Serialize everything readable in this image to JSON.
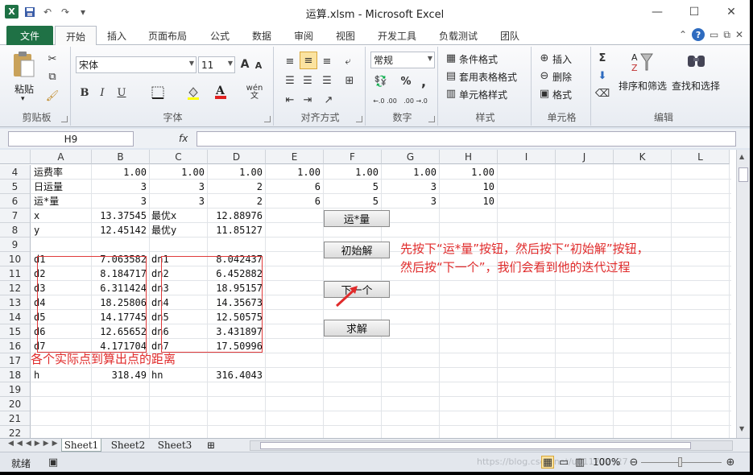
{
  "window": {
    "title": "运算.xlsm - Microsoft Excel",
    "controls": [
      "—",
      "☐",
      "✕"
    ]
  },
  "qat": {
    "logo": "X"
  },
  "tabs": {
    "file": "文件",
    "items": [
      "开始",
      "插入",
      "页面布局",
      "公式",
      "数据",
      "审阅",
      "视图",
      "开发工具",
      "负载测试",
      "团队"
    ],
    "active_index": 0
  },
  "ribbon": {
    "clipboard": {
      "paste": "粘贴",
      "label": "剪贴板"
    },
    "font": {
      "name": "宋体",
      "size": "11",
      "label": "字体",
      "bold": "B",
      "italic": "I",
      "underline": "U",
      "grow": "A",
      "shrink": "A",
      "wen": "wén"
    },
    "alignment": {
      "label": "对齐方式"
    },
    "number": {
      "format": "常规",
      "label": "数字",
      "percent": "%",
      "comma": ",",
      "inc": "←.0 .00",
      "dec": ".00 →.0"
    },
    "styles": {
      "cond": "条件格式",
      "table": "套用表格格式",
      "cell": "单元格样式",
      "label": "样式"
    },
    "cells": {
      "insert": "插入",
      "delete": "删除",
      "format": "格式",
      "label": "单元格"
    },
    "editing": {
      "sigma": "Σ",
      "sort": "排序和筛选",
      "find": "查找和选择",
      "label": "编辑"
    },
    "accent": "#1f7145"
  },
  "formula_bar": {
    "name_box": "H9",
    "fx": "fx",
    "value": ""
  },
  "columns": [
    "A",
    "B",
    "C",
    "D",
    "E",
    "F",
    "G",
    "H",
    "I",
    "J",
    "K",
    "L"
  ],
  "rows": [
    {
      "num": "4",
      "cells": {
        "A": "运费率",
        "B": "1.00",
        "C": "1.00",
        "D": "1.00",
        "E": "1.00",
        "F": "1.00",
        "G": "1.00",
        "H": "1.00"
      }
    },
    {
      "num": "5",
      "cells": {
        "A": "日运量",
        "B": "3",
        "C": "3",
        "D": "2",
        "E": "6",
        "F": "5",
        "G": "3",
        "H": "10"
      }
    },
    {
      "num": "6",
      "cells": {
        "A": "运*量",
        "B": "3",
        "C": "3",
        "D": "2",
        "E": "6",
        "F": "5",
        "G": "3",
        "H": "10"
      }
    },
    {
      "num": "7",
      "cells": {
        "A": "x",
        "B": "13.37545",
        "C": "最优x",
        "D": "12.88976"
      }
    },
    {
      "num": "8",
      "cells": {
        "A": "y",
        "B": "12.45142",
        "C": "最优y",
        "D": "11.85127"
      }
    },
    {
      "num": "9",
      "cells": {}
    },
    {
      "num": "10",
      "cells": {
        "A": "d1",
        "B": "7.063582",
        "C": "dn1",
        "D": "8.042437"
      }
    },
    {
      "num": "11",
      "cells": {
        "A": "d2",
        "B": "8.184717",
        "C": "dn2",
        "D": "6.452882"
      }
    },
    {
      "num": "12",
      "cells": {
        "A": "d3",
        "B": "6.311424",
        "C": "dn3",
        "D": "18.95157"
      }
    },
    {
      "num": "13",
      "cells": {
        "A": "d4",
        "B": "18.25806",
        "C": "dn4",
        "D": "14.35673"
      }
    },
    {
      "num": "14",
      "cells": {
        "A": "d5",
        "B": "14.17745",
        "C": "dn5",
        "D": "12.50575"
      }
    },
    {
      "num": "15",
      "cells": {
        "A": "d6",
        "B": "12.65652",
        "C": "dn6",
        "D": "3.431897"
      }
    },
    {
      "num": "16",
      "cells": {
        "A": "d7",
        "B": "4.171704",
        "C": "dn7",
        "D": "17.50996"
      }
    },
    {
      "num": "17",
      "cells": {}
    },
    {
      "num": "18",
      "cells": {
        "A": "h",
        "B": "318.49",
        "C": "hn",
        "D": "316.4043"
      }
    },
    {
      "num": "19",
      "cells": {}
    },
    {
      "num": "20",
      "cells": {}
    },
    {
      "num": "21",
      "cells": {}
    },
    {
      "num": "22",
      "cells": {}
    }
  ],
  "buttons": {
    "b1": "运*量",
    "b2": "初始解",
    "b3": "下一个",
    "b4": "求解"
  },
  "annotations": {
    "line1": "先按下“运*量”按钮，然后按下“初始解”按钮，",
    "line2": "然后按“下一个”，我们会看到他的迭代过程",
    "distance": "各个实际点到算出点的距离",
    "color": "#e02b2b"
  },
  "sheets": [
    "Sheet1",
    "Sheet2",
    "Sheet3"
  ],
  "status": {
    "ready": "就绪",
    "zoom": "100%",
    "watermark": "https://blog.csdn.net/u011772927"
  }
}
